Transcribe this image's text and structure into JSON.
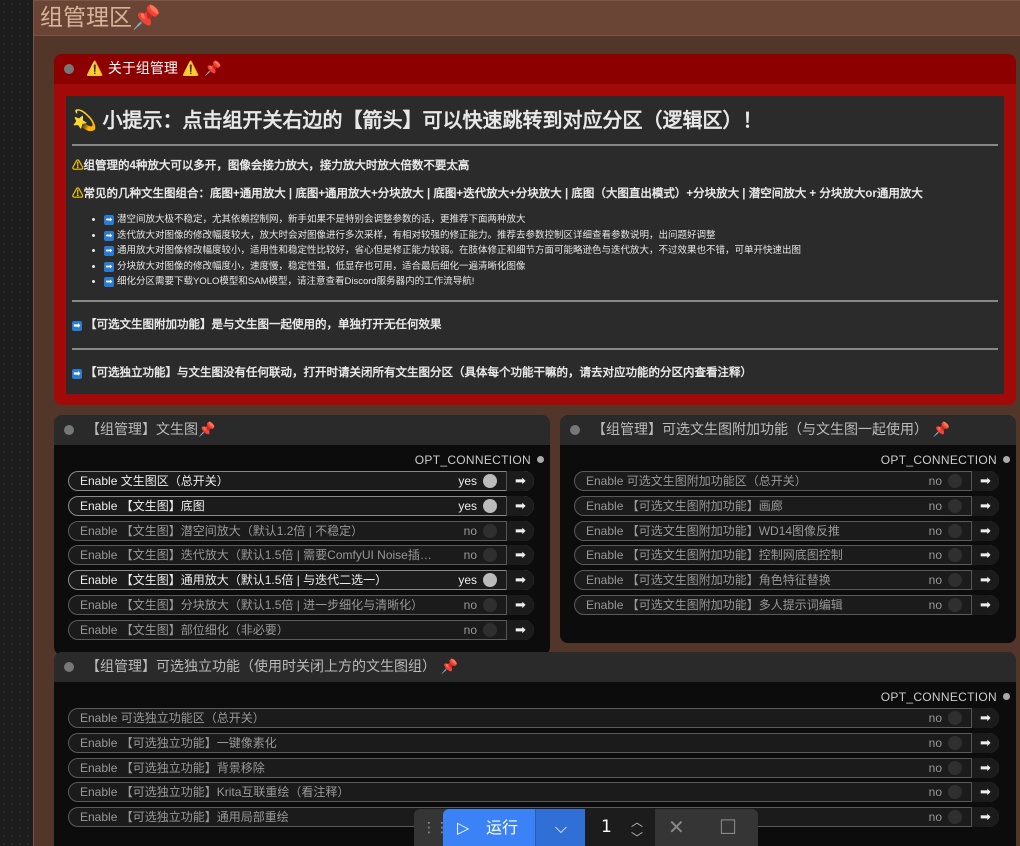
{
  "group": {
    "title": "组管理区",
    "pin": "📌"
  },
  "info_node": {
    "title": "⚠️ 关于组管理 ⚠️",
    "headline": "小提示：点击组开关右边的【箭头】可以快速跳转到对应分区（逻辑区）！",
    "headline_icon": "💫",
    "p1": "组管理的4种放大可以多开，图像会接力放大，接力放大时放大倍数不要太高",
    "p2": "常见的几种文生图组合：底图+通用放大 | 底图+通用放大+分块放大 | 底图+迭代放大+分块放大 | 底图（大图直出模式）+分块放大 | 潜空间放大 + 分块放大or通用放大",
    "bullets": [
      "潜空间放大极不稳定，尤其依赖控制网，新手如果不是特别会调整参数的话，更推荐下面两种放大",
      "迭代放大对图像的修改幅度较大，放大时会对图像进行多次采样，有相对较强的修正能力。推荐去参数控制区详细查看参数说明，出问题好调整",
      "通用放大对图像修改幅度较小，适用性和稳定性比较好，省心但是修正能力较弱。在肢体修正和细节方面可能略逊色与迭代放大，不过效果也不错，可单开快速出图",
      "分块放大对图像的修改幅度小，速度慢，稳定性强，低显存也可用，适合最后细化一遍清晰化图像",
      "细化分区需要下载YOLO模型和SAM模型，请注意查看Discord服务器内的工作流导航!"
    ],
    "p3": "【可选文生图附加功能】是与文生图一起使用的，单独打开无任何效果",
    "p4": "【可选独立功能】与文生图没有任何联动，打开时请关闭所有文生图分区（具体每个功能干嘛的，请去对应功能的分区内查看注释）"
  },
  "node_t2i": {
    "title": "【组管理】文生图",
    "opt": "OPT_CONNECTION",
    "toggles": [
      {
        "label": "Enable 文生图区（总开关）",
        "value": "yes",
        "on": true
      },
      {
        "label": "Enable 【文生图】底图",
        "value": "yes",
        "on": true
      },
      {
        "label": "Enable 【文生图】潜空间放大（默认1.2倍 | 不稳定）",
        "value": "no",
        "on": false
      },
      {
        "label": "Enable 【文生图】迭代放大（默认1.5倍 | 需要ComfyUI Noise插件）",
        "value": "no",
        "on": false
      },
      {
        "label": "Enable 【文生图】通用放大（默认1.5倍 | 与迭代二选一）",
        "value": "yes",
        "on": true
      },
      {
        "label": "Enable 【文生图】分块放大（默认1.5倍 | 进一步细化与清晰化）",
        "value": "no",
        "on": false
      },
      {
        "label": "Enable 【文生图】部位细化（非必要）",
        "value": "no",
        "on": false
      }
    ]
  },
  "node_addon": {
    "title": "【组管理】可选文生图附加功能（与文生图一起使用）",
    "opt": "OPT_CONNECTION",
    "toggles": [
      {
        "label": "Enable 可选文生图附加功能区（总开关）",
        "value": "no",
        "on": false
      },
      {
        "label": "Enable 【可选文生图附加功能】画廊",
        "value": "no",
        "on": false
      },
      {
        "label": "Enable 【可选文生图附加功能】WD14图像反推",
        "value": "no",
        "on": false
      },
      {
        "label": "Enable 【可选文生图附加功能】控制网底图控制",
        "value": "no",
        "on": false
      },
      {
        "label": "Enable 【可选文生图附加功能】角色特征替换",
        "value": "no",
        "on": false
      },
      {
        "label": "Enable 【可选文生图附加功能】多人提示词编辑",
        "value": "no",
        "on": false
      }
    ]
  },
  "node_standalone": {
    "title": "【组管理】可选独立功能（使用时关闭上方的文生图组）",
    "opt": "OPT_CONNECTION",
    "toggles": [
      {
        "label": "Enable 可选独立功能区（总开关）",
        "value": "no",
        "on": false
      },
      {
        "label": "Enable 【可选独立功能】一键像素化",
        "value": "no",
        "on": false
      },
      {
        "label": "Enable 【可选独立功能】背景移除",
        "value": "no",
        "on": false
      },
      {
        "label": "Enable 【可选独立功能】Krita互联重绘（看注释）",
        "value": "no",
        "on": false
      },
      {
        "label": "Enable 【可选独立功能】通用局部重绘",
        "value": "no",
        "on": false
      }
    ]
  },
  "toolbar": {
    "run_label": "运行",
    "batch_count": "1"
  },
  "colors": {
    "accent": "#3b82f6",
    "info_red": "#a20a0a",
    "group_bg": "#53362a"
  }
}
